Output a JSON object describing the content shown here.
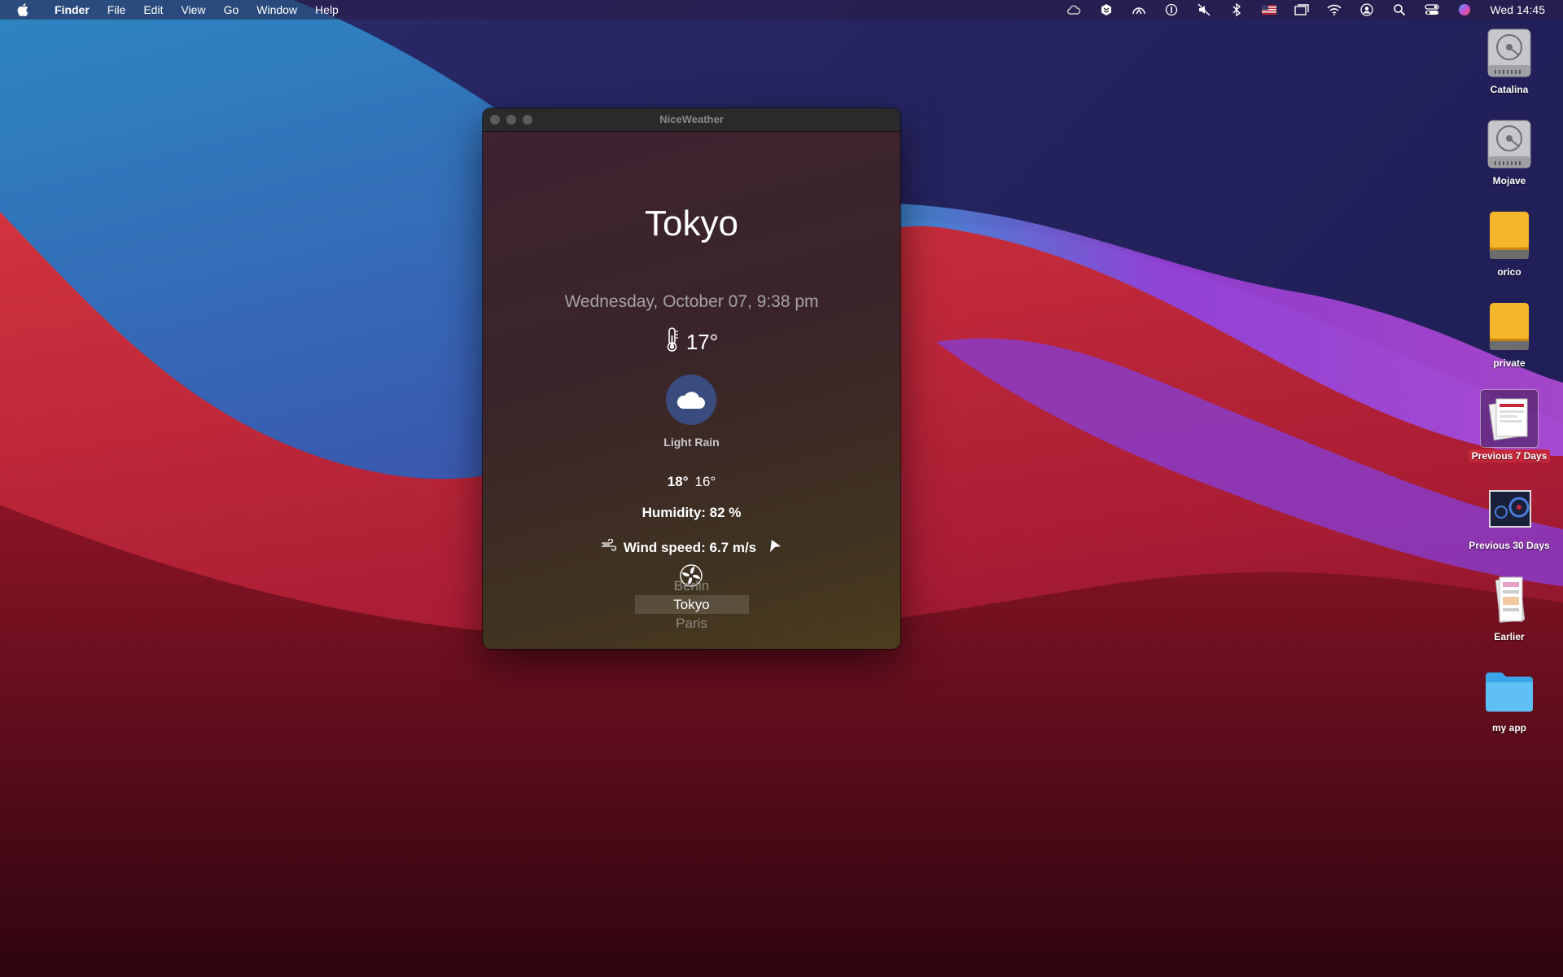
{
  "menubar": {
    "app_name": "Finder",
    "items": [
      "File",
      "Edit",
      "View",
      "Go",
      "Window",
      "Help"
    ],
    "clock": "Wed 14:45",
    "status_icons": [
      "creative-cloud-icon",
      "dropbox-icon",
      "vpn-icon",
      "password-icon",
      "mute-icon",
      "bluetooth-icon",
      "input-flag-icon",
      "screens-icon",
      "wifi-icon",
      "user-icon",
      "search-icon",
      "control-center-icon",
      "siri-icon"
    ]
  },
  "window": {
    "title": "NiceWeather",
    "city": "Tokyo",
    "date": "Wednesday, October 07, 9:38 pm",
    "temperature": "17°",
    "condition": "Light Rain",
    "high": "18°",
    "low": "16°",
    "humidity": "Humidity: 82 %",
    "wind": "Wind speed: 6.7 m/s",
    "city_picker": [
      "Berlin",
      "Tokyo",
      "Paris"
    ],
    "selected_city": "Tokyo"
  },
  "desktop": {
    "icons": [
      {
        "label": "Catalina",
        "kind": "hard-disk-icon"
      },
      {
        "label": "Mojave",
        "kind": "hard-disk-icon"
      },
      {
        "label": "orico",
        "kind": "external-drive-icon"
      },
      {
        "label": "private",
        "kind": "external-drive-icon"
      },
      {
        "label": "Previous 7 Days",
        "kind": "screenshot-stack-icon",
        "selected": true
      },
      {
        "label": "Previous 30 Days",
        "kind": "screenshot-stack-icon"
      },
      {
        "label": "Earlier",
        "kind": "screenshot-stack-icon"
      },
      {
        "label": "my app",
        "kind": "folder-icon"
      }
    ]
  },
  "colors": {
    "selection_red": "#c8283b",
    "weather_badge": "#3a4b7e"
  }
}
